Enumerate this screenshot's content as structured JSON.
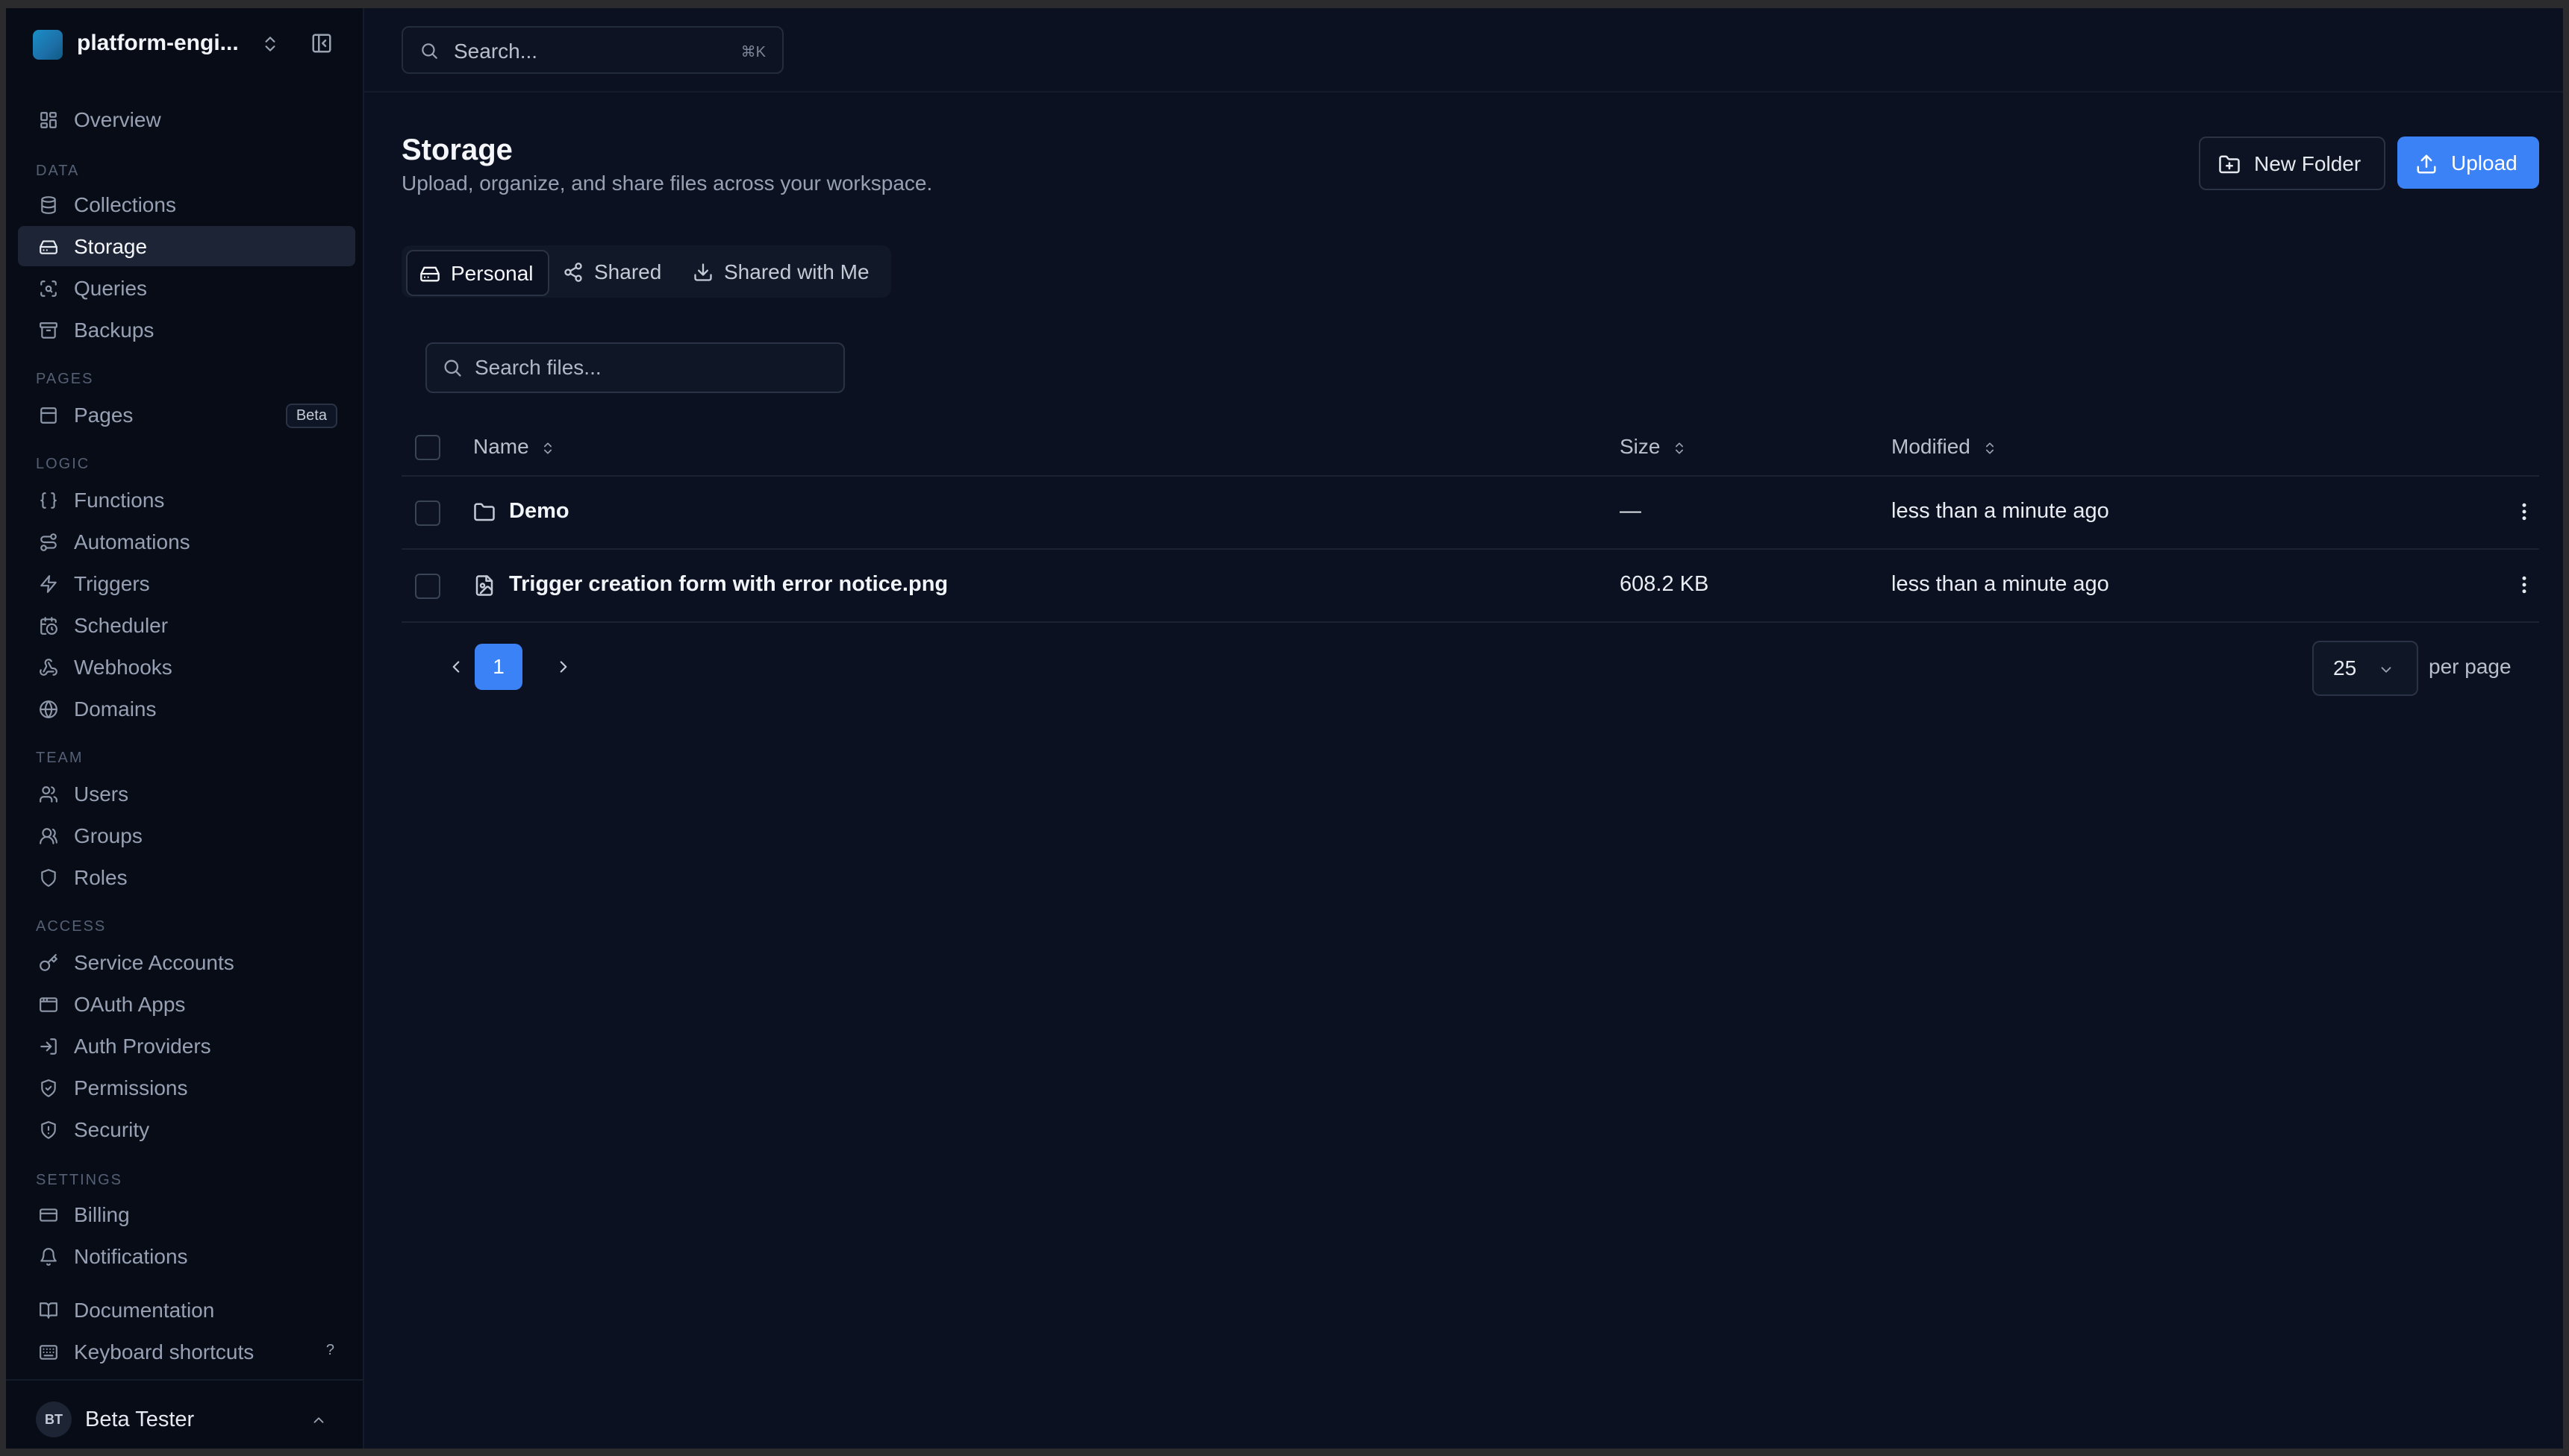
{
  "workspace": {
    "name": "platform-engi..."
  },
  "sidebar": {
    "overview": "Overview",
    "sections": {
      "data": "DATA",
      "pages": "PAGES",
      "logic": "LOGIC",
      "team": "TEAM",
      "access": "ACCESS",
      "settings": "SETTINGS"
    },
    "items": {
      "collections": "Collections",
      "storage": "Storage",
      "queries": "Queries",
      "backups": "Backups",
      "pages": "Pages",
      "functions": "Functions",
      "automations": "Automations",
      "triggers": "Triggers",
      "scheduler": "Scheduler",
      "webhooks": "Webhooks",
      "domains": "Domains",
      "users": "Users",
      "groups": "Groups",
      "roles": "Roles",
      "service_accounts": "Service Accounts",
      "oauth_apps": "OAuth Apps",
      "auth_providers": "Auth Providers",
      "permissions": "Permissions",
      "security": "Security",
      "billing": "Billing",
      "notifications": "Notifications",
      "documentation": "Documentation",
      "keyboard_shortcuts": "Keyboard shortcuts"
    },
    "pages_badge": "Beta",
    "shortcut_hint": "?",
    "active": "Storage"
  },
  "user": {
    "initials": "BT",
    "name": "Beta Tester"
  },
  "topbar": {
    "search_placeholder": "Search...",
    "search_shortcut": "⌘K"
  },
  "page": {
    "title": "Storage",
    "subtitle": "Upload, organize, and share files across your workspace.",
    "new_folder": "New Folder",
    "upload": "Upload"
  },
  "tabs": {
    "personal": "Personal",
    "shared": "Shared",
    "shared_with_me": "Shared with Me",
    "active": "Personal"
  },
  "files": {
    "search_placeholder": "Search files...",
    "columns": {
      "name": "Name",
      "size": "Size",
      "modified": "Modified"
    },
    "rows": [
      {
        "name": "Demo",
        "type": "folder",
        "size": "—",
        "modified": "less than a minute ago"
      },
      {
        "name": "Trigger creation form with error notice.png",
        "type": "image",
        "size": "608.2 KB",
        "modified": "less than a minute ago"
      }
    ]
  },
  "pagination": {
    "current_page": "1",
    "per_page_value": "25",
    "per_page_label": "per page"
  },
  "colors": {
    "accent": "#3b82f6",
    "background": "#0b1120",
    "sidebar": "#070c17",
    "notification_dot": "#22c55e"
  }
}
